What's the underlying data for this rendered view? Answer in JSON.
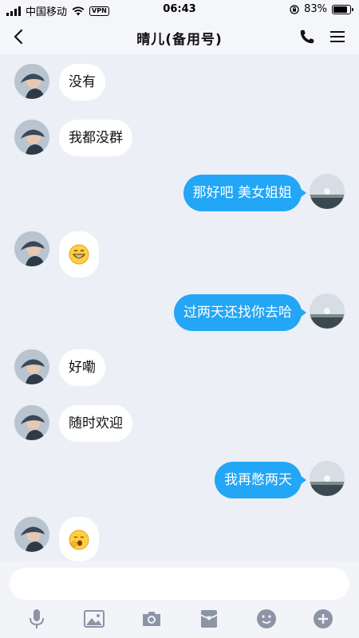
{
  "status_bar": {
    "carrier": "中国移动",
    "vpn": "VPN",
    "time": "06:43",
    "battery": "83%",
    "battery_level": 0.83
  },
  "header": {
    "title": "晴儿(备用号)",
    "back_icon": "chevron-left-icon",
    "call_icon": "phone-icon",
    "menu_icon": "hamburger-menu-icon"
  },
  "messages": [
    {
      "side": "in",
      "text": "没有"
    },
    {
      "side": "in",
      "text": "我都没群"
    },
    {
      "side": "out",
      "text": "那好吧 美女姐姐"
    },
    {
      "side": "in",
      "emoji": "grinning-face-emoji"
    },
    {
      "side": "out",
      "text": "过两天还找你去哈"
    },
    {
      "side": "in",
      "text": "好嘞"
    },
    {
      "side": "in",
      "text": "随时欢迎"
    },
    {
      "side": "out",
      "text": "我再憋两天"
    },
    {
      "side": "in",
      "emoji": "yawning-face-emoji"
    }
  ],
  "input": {
    "value": "",
    "placeholder": ""
  },
  "toolbar": {
    "icons": [
      "microphone-icon",
      "image-icon",
      "camera-icon",
      "red-packet-icon",
      "emoji-icon",
      "plus-icon"
    ]
  },
  "colors": {
    "background": "#eceff6",
    "outgoing_bubble": "#22a6f5",
    "incoming_bubble": "#ffffff",
    "toolbar_icons": "#8d94a6"
  }
}
